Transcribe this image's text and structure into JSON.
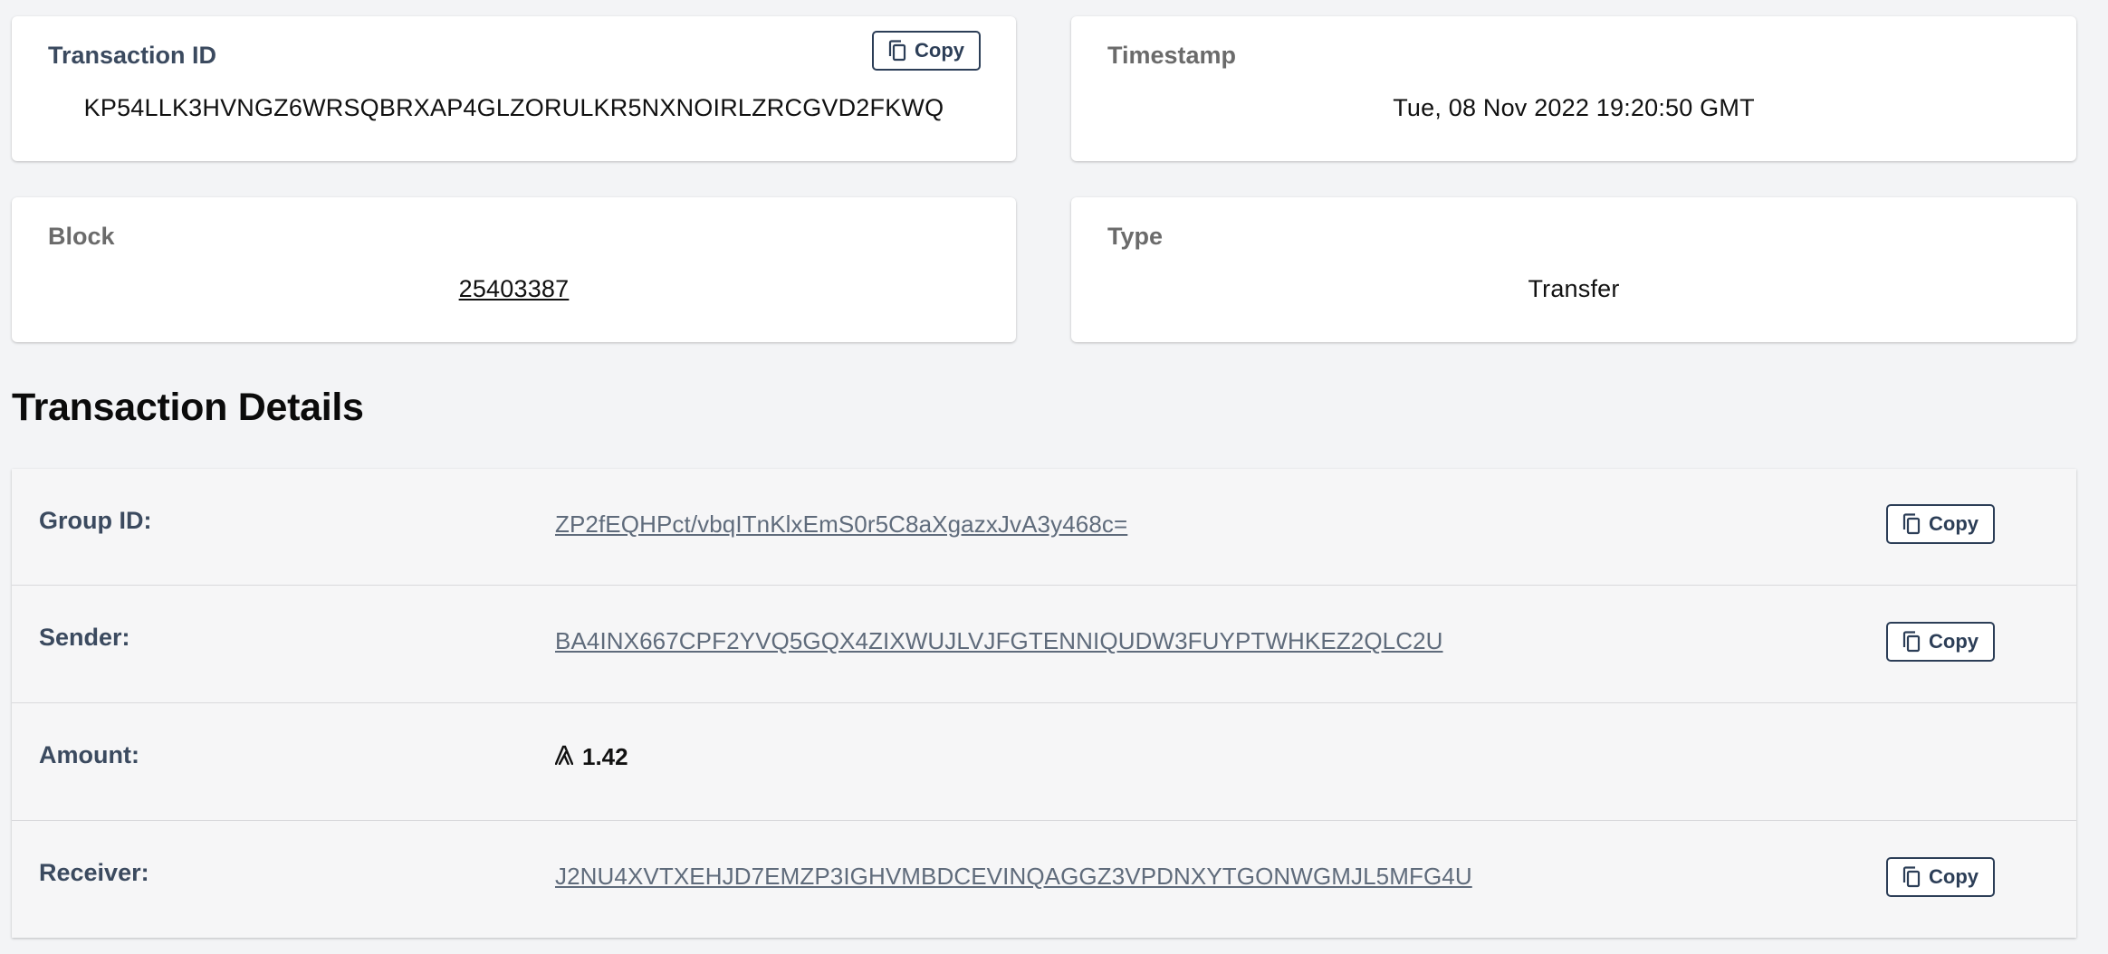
{
  "top_cards": {
    "transaction_id": {
      "title": "Transaction ID",
      "value": "KP54LLK3HVNGZ6WRSQBRXAP4GLZORULKR5NXNOIRLZRCGVD2FKWQ",
      "copy_label": "Copy"
    },
    "timestamp": {
      "title": "Timestamp",
      "value": "Tue, 08 Nov 2022 19:20:50 GMT"
    },
    "block": {
      "title": "Block",
      "value": "25403387"
    },
    "type": {
      "title": "Type",
      "value": "Transfer"
    }
  },
  "details": {
    "title": "Transaction Details",
    "group_id": {
      "label": "Group ID:",
      "value": "ZP2fEQHPct/vbqITnKlxEmS0r5C8aXgazxJvA3y468c=",
      "copy_label": "Copy"
    },
    "sender": {
      "label": "Sender:",
      "value": "BA4INX667CPF2YVQ5GQX4ZIXWUJLVJFGTENNIQUDW3FUYPTWHKEZ2QLC2U",
      "copy_label": "Copy"
    },
    "amount": {
      "label": "Amount:",
      "value": "1.42",
      "icon": "algorand-icon"
    },
    "receiver": {
      "label": "Receiver:",
      "value": "J2NU4XVTXEHJD7EMZP3IGHVMBDCEVINQAGGZ3VPDNXYTGONWGMJL5MFG4U",
      "copy_label": "Copy"
    }
  },
  "colors": {
    "label_navy": "#3b4a5f",
    "link_grey": "#5f6b7b",
    "background": "#f3f4f6",
    "button_border": "#2c3e57"
  }
}
